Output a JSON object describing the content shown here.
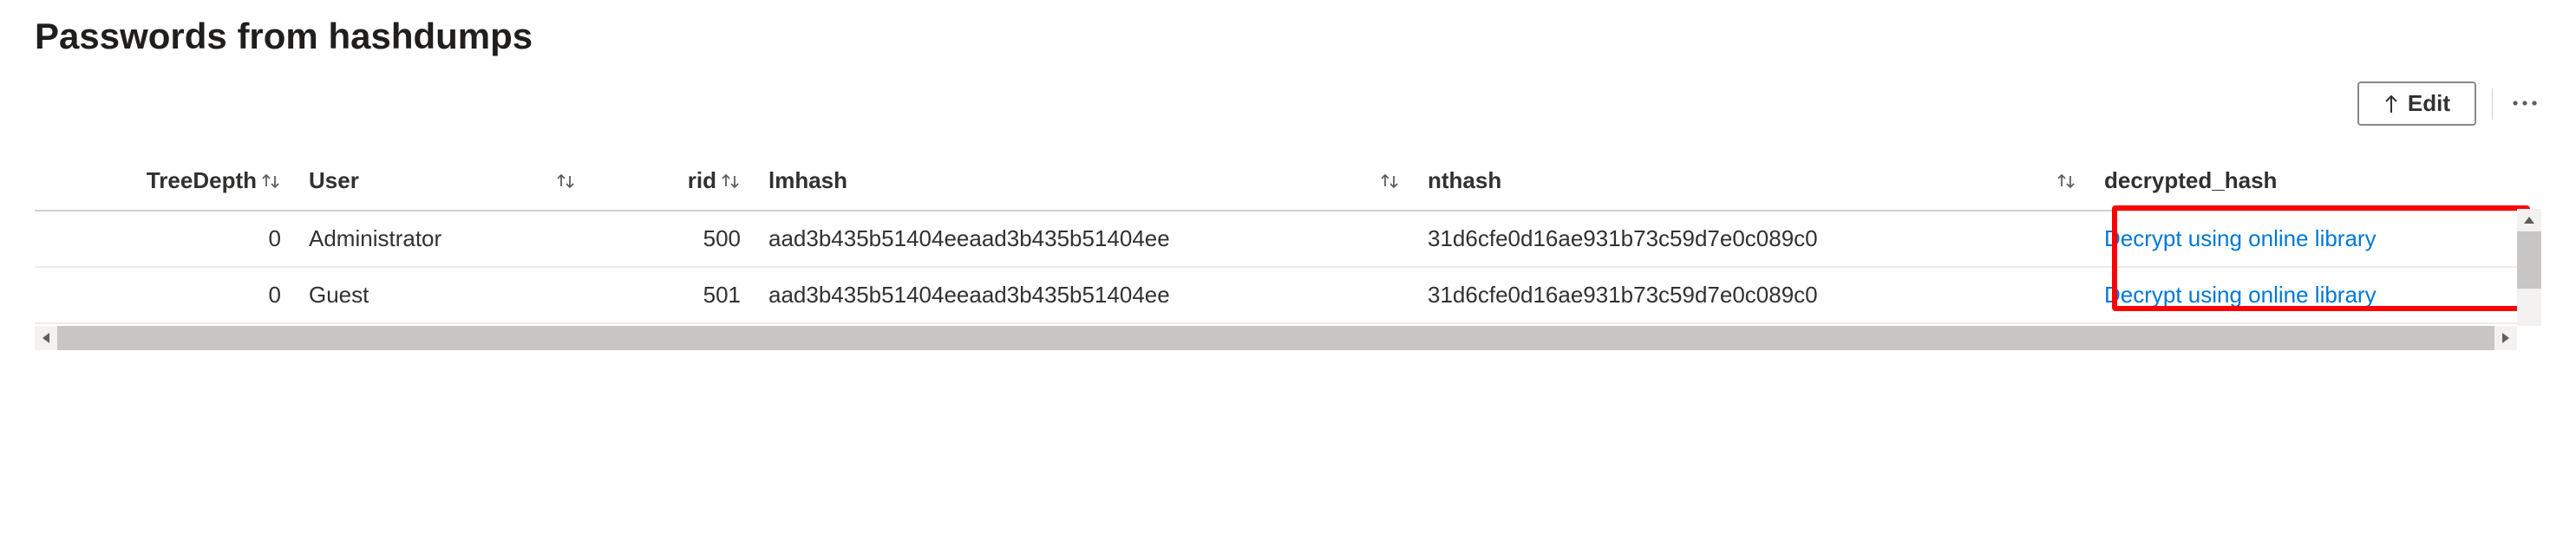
{
  "title": "Passwords from hashdumps",
  "toolbar": {
    "edit_label": "Edit"
  },
  "columns": {
    "treedepth": "TreeDepth",
    "user": "User",
    "rid": "rid",
    "lmhash": "lmhash",
    "nthash": "nthash",
    "decrypted": "decrypted_hash"
  },
  "rows": [
    {
      "treedepth": "0",
      "user": "Administrator",
      "rid": "500",
      "lmhash": "aad3b435b51404eeaad3b435b51404ee",
      "nthash": "31d6cfe0d16ae931b73c59d7e0c089c0",
      "decrypted": "Decrypt using online library"
    },
    {
      "treedepth": "0",
      "user": "Guest",
      "rid": "501",
      "lmhash": "aad3b435b51404eeaad3b435b51404ee",
      "nthash": "31d6cfe0d16ae931b73c59d7e0c089c0",
      "decrypted": "Decrypt using online library"
    }
  ]
}
